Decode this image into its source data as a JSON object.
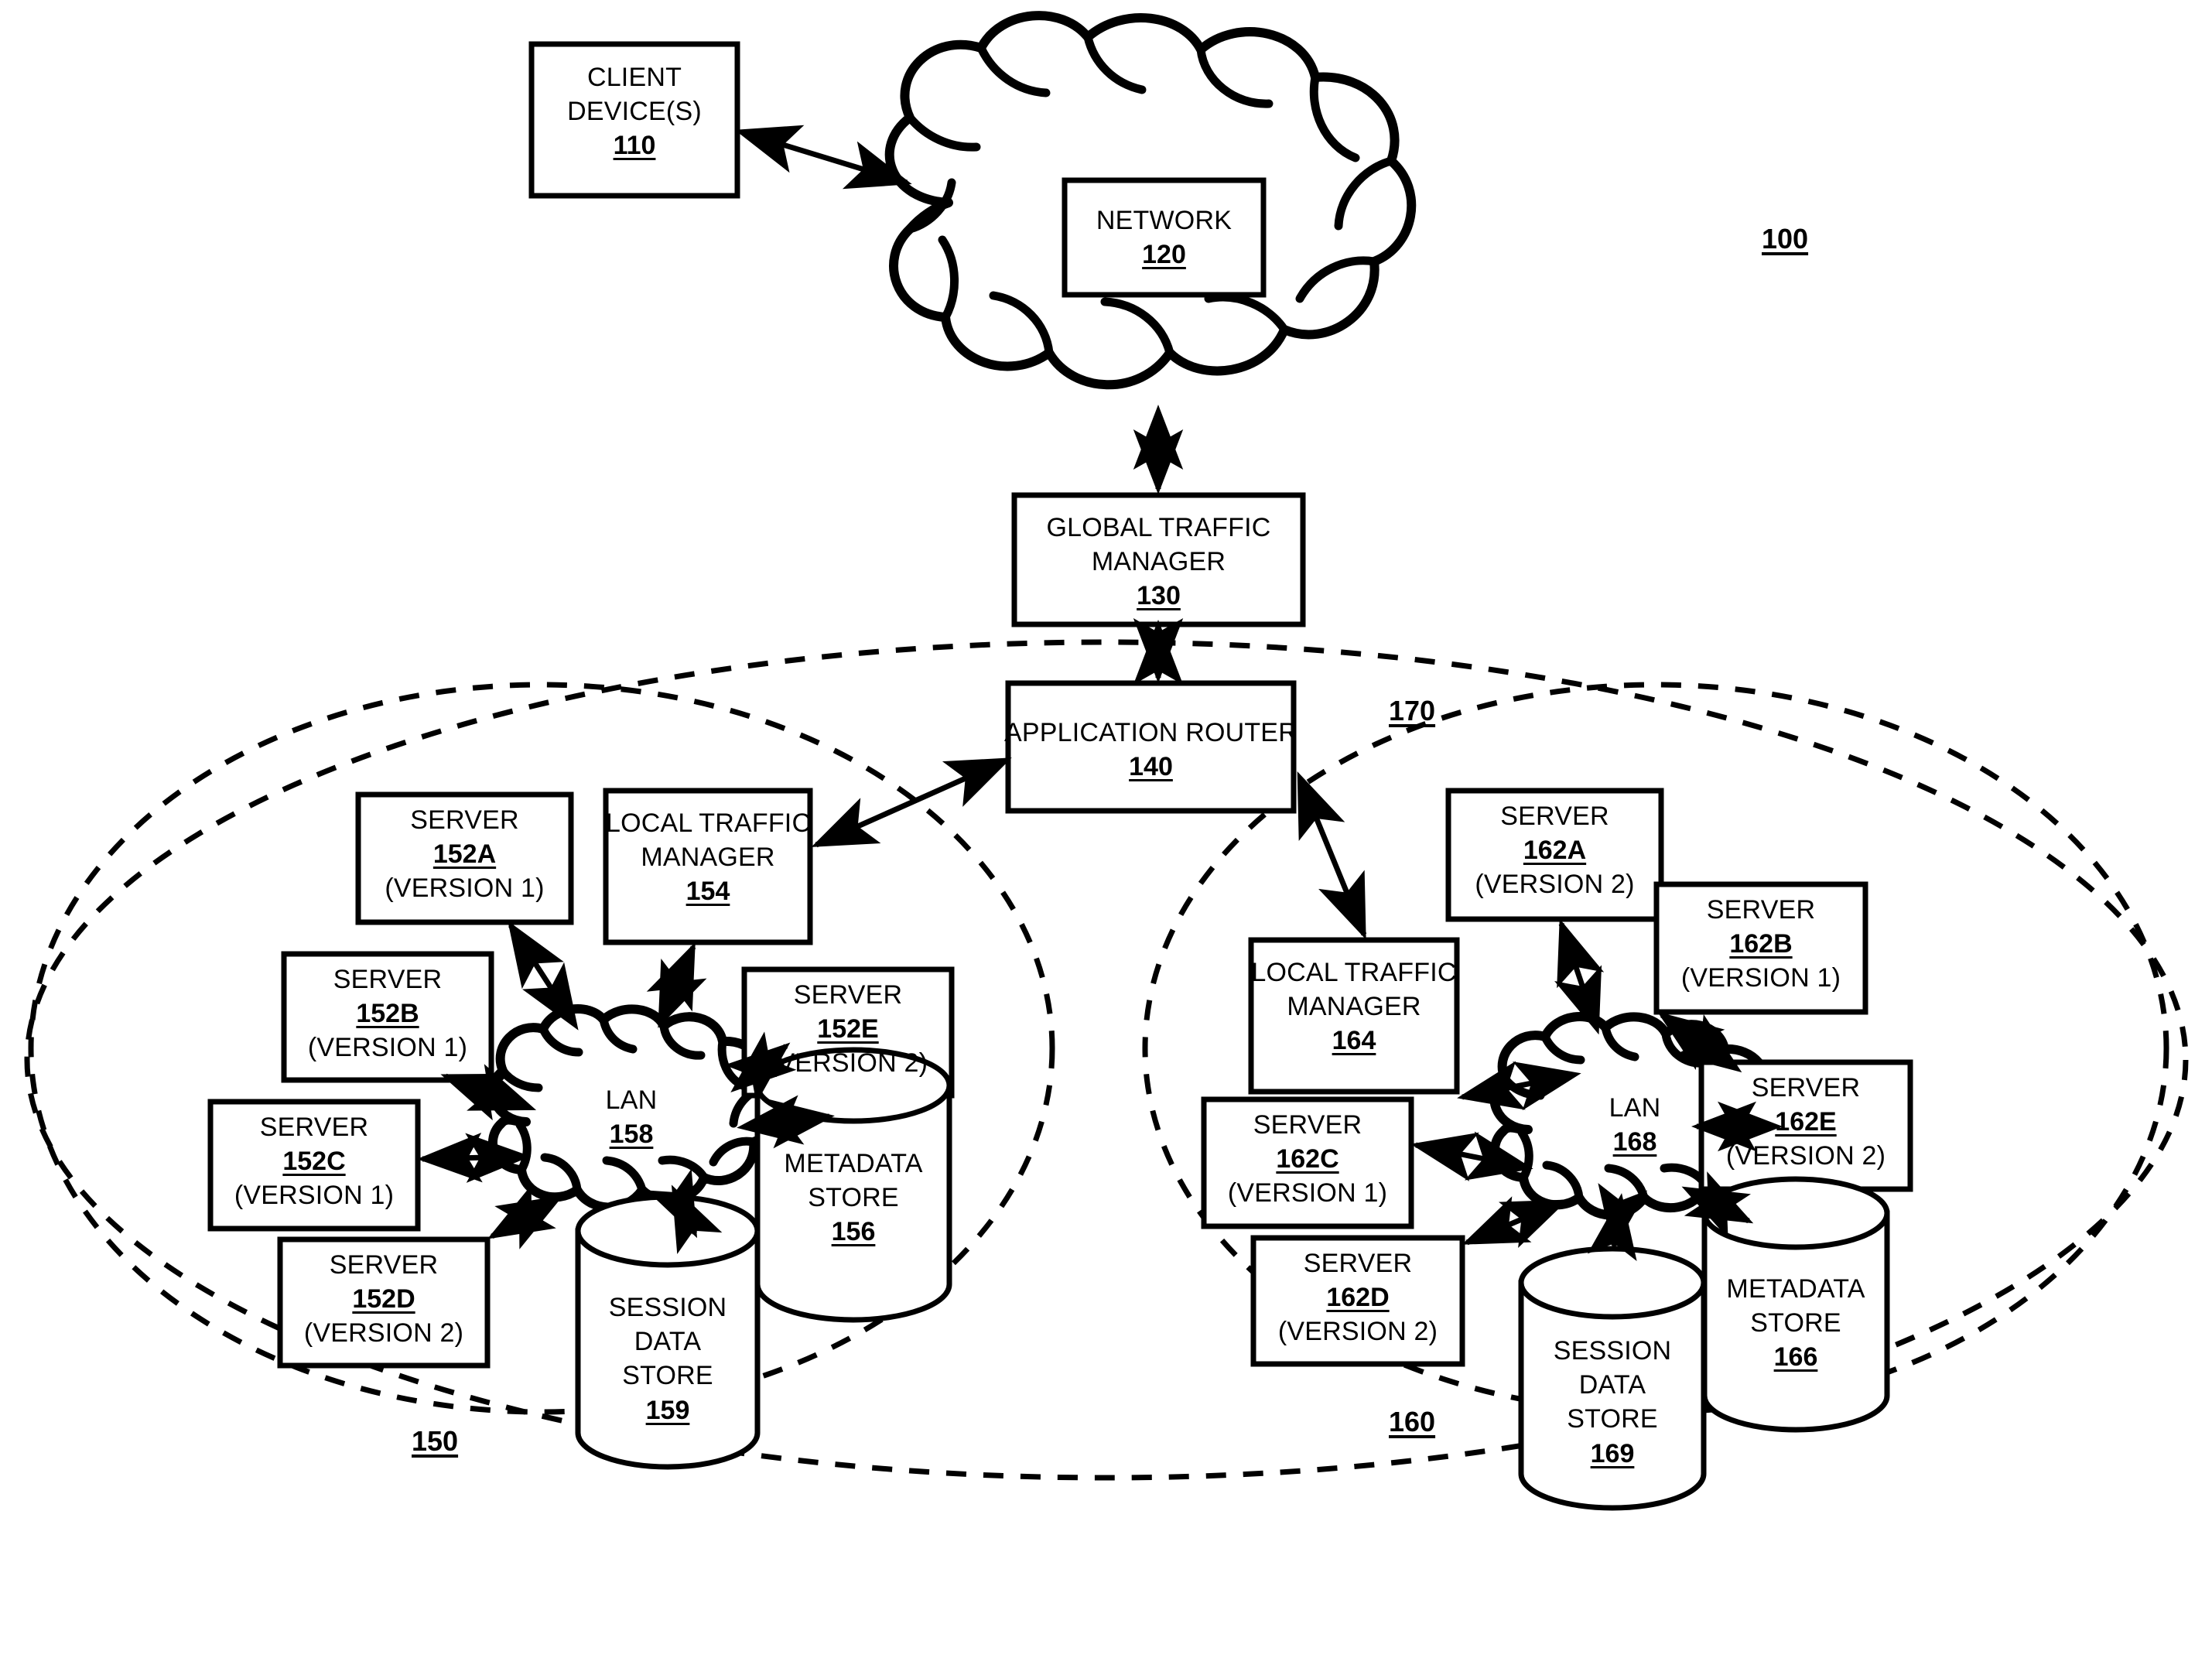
{
  "figure": {
    "figure_ref": "100",
    "type": "network-architecture-diagram"
  },
  "nodes": {
    "client_devices": {
      "line1": "CLIENT",
      "line2": "DEVICE(S)",
      "ref": "110"
    },
    "network": {
      "line1": "NETWORK",
      "ref": "120"
    },
    "global_traffic_manager": {
      "line1": "GLOBAL TRAFFIC",
      "line2": "MANAGER",
      "ref": "130"
    },
    "application_router": {
      "line1": "APPLICATION ROUTER",
      "ref": "140"
    },
    "datacenter_left": {
      "ref": "150"
    },
    "datacenter_right": {
      "ref": "160"
    },
    "system_boundary": {
      "ref": "170"
    },
    "server_152a": {
      "line1": "SERVER",
      "ref": "152A",
      "version": "(VERSION 1)"
    },
    "server_152b": {
      "line1": "SERVER",
      "ref": "152B",
      "version": "(VERSION 1)"
    },
    "server_152c": {
      "line1": "SERVER",
      "ref": "152C",
      "version": "(VERSION 1)"
    },
    "server_152d": {
      "line1": "SERVER",
      "ref": "152D",
      "version": "(VERSION 2)"
    },
    "server_152e": {
      "line1": "SERVER",
      "ref": "152E",
      "version": "(VERSION 2)"
    },
    "local_traffic_manager_154": {
      "line1": "LOCAL TRAFFIC",
      "line2": "MANAGER",
      "ref": "154"
    },
    "metadata_store_156": {
      "line1": "METADATA",
      "line2": "STORE",
      "ref": "156"
    },
    "lan_158": {
      "line1": "LAN",
      "ref": "158"
    },
    "session_data_store_159": {
      "line1": "SESSION",
      "line2": "DATA",
      "line3": "STORE",
      "ref": "159"
    },
    "server_162a": {
      "line1": "SERVER",
      "ref": "162A",
      "version": "(VERSION 2)"
    },
    "server_162b": {
      "line1": "SERVER",
      "ref": "162B",
      "version": "(VERSION 1)"
    },
    "server_162c": {
      "line1": "SERVER",
      "ref": "162C",
      "version": "(VERSION 1)"
    },
    "server_162d": {
      "line1": "SERVER",
      "ref": "162D",
      "version": "(VERSION 2)"
    },
    "server_162e": {
      "line1": "SERVER",
      "ref": "162E",
      "version": "(VERSION 2)"
    },
    "local_traffic_manager_164": {
      "line1": "LOCAL TRAFFIC",
      "line2": "MANAGER",
      "ref": "164"
    },
    "metadata_store_166": {
      "line1": "METADATA",
      "line2": "STORE",
      "ref": "166"
    },
    "lan_168": {
      "line1": "LAN",
      "ref": "168"
    },
    "session_data_store_169": {
      "line1": "SESSION",
      "line2": "DATA",
      "line3": "STORE",
      "ref": "169"
    }
  },
  "colors": {
    "stroke": "#000000",
    "fill": "#ffffff",
    "background": "#ffffff"
  },
  "connections": [
    {
      "from": "client_devices",
      "to": "network",
      "arrow": "both"
    },
    {
      "from": "network",
      "to": "global_traffic_manager",
      "arrow": "both"
    },
    {
      "from": "global_traffic_manager",
      "to": "application_router",
      "arrow": "both"
    },
    {
      "from": "application_router",
      "to": "local_traffic_manager_154",
      "arrow": "both"
    },
    {
      "from": "application_router",
      "to": "local_traffic_manager_164",
      "arrow": "both"
    },
    {
      "from": "lan_158",
      "to": "server_152a",
      "arrow": "both"
    },
    {
      "from": "lan_158",
      "to": "server_152b",
      "arrow": "both"
    },
    {
      "from": "lan_158",
      "to": "server_152c",
      "arrow": "both"
    },
    {
      "from": "lan_158",
      "to": "server_152d",
      "arrow": "both"
    },
    {
      "from": "lan_158",
      "to": "server_152e",
      "arrow": "both"
    },
    {
      "from": "lan_158",
      "to": "local_traffic_manager_154",
      "arrow": "both"
    },
    {
      "from": "lan_158",
      "to": "metadata_store_156",
      "arrow": "both"
    },
    {
      "from": "lan_158",
      "to": "session_data_store_159",
      "arrow": "both"
    },
    {
      "from": "lan_168",
      "to": "server_162a",
      "arrow": "both"
    },
    {
      "from": "lan_168",
      "to": "server_162b",
      "arrow": "both"
    },
    {
      "from": "lan_168",
      "to": "server_162c",
      "arrow": "both"
    },
    {
      "from": "lan_168",
      "to": "server_162d",
      "arrow": "both"
    },
    {
      "from": "lan_168",
      "to": "server_162e",
      "arrow": "both"
    },
    {
      "from": "lan_168",
      "to": "local_traffic_manager_164",
      "arrow": "both"
    },
    {
      "from": "lan_168",
      "to": "metadata_store_166",
      "arrow": "both"
    },
    {
      "from": "lan_168",
      "to": "session_data_store_169",
      "arrow": "both"
    }
  ]
}
